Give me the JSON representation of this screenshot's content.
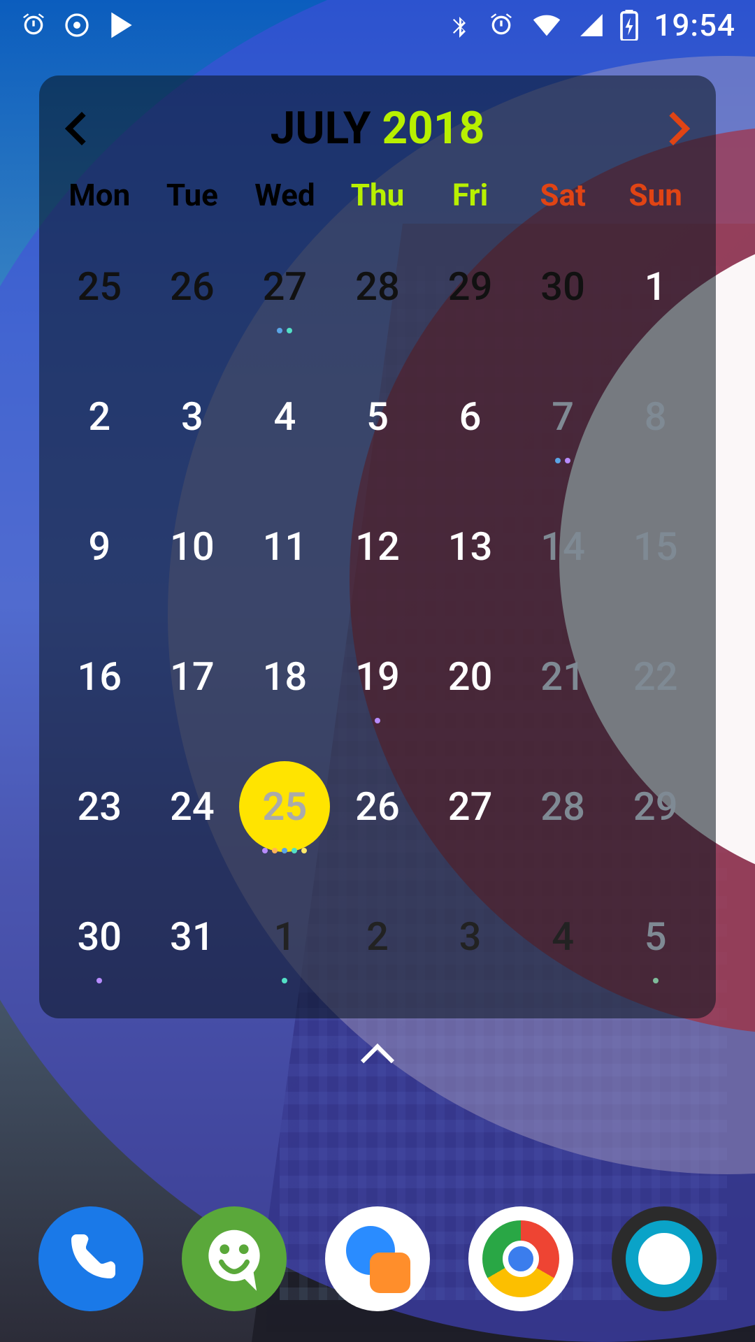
{
  "statusbar": {
    "time": "19:54",
    "left_icons": [
      "alarm-icon",
      "target-icon",
      "play-store-icon"
    ],
    "right_icons": [
      "bluetooth-icon",
      "alarm-icon",
      "wifi-icon",
      "cell-signal-icon",
      "battery-charging-icon"
    ]
  },
  "calendar": {
    "title_month": "JULY",
    "title_year": "2018",
    "prev_label": "Previous month",
    "next_label": "Next month",
    "dow": [
      "Mon",
      "Tue",
      "Wed",
      "Thu",
      "Fri",
      "Sat",
      "Sun"
    ],
    "dow_style": [
      "plain",
      "plain",
      "plain",
      "mid",
      "mid",
      "wknd sat",
      "wknd sun"
    ],
    "cells": [
      {
        "n": "25",
        "cls": "prev"
      },
      {
        "n": "26",
        "cls": "prev"
      },
      {
        "n": "27",
        "cls": "prev",
        "dots": [
          "b",
          "t"
        ]
      },
      {
        "n": "28",
        "cls": "prev"
      },
      {
        "n": "29",
        "cls": "prev"
      },
      {
        "n": "30",
        "cls": "prev"
      },
      {
        "n": "1",
        "cls": "cur"
      },
      {
        "n": "2",
        "cls": "cur"
      },
      {
        "n": "3",
        "cls": "cur"
      },
      {
        "n": "4",
        "cls": "cur"
      },
      {
        "n": "5",
        "cls": "cur"
      },
      {
        "n": "6",
        "cls": "cur"
      },
      {
        "n": "7",
        "cls": "cur wk-dim",
        "dots": [
          "b",
          "p"
        ]
      },
      {
        "n": "8",
        "cls": "cur wk-dim"
      },
      {
        "n": "9",
        "cls": "cur"
      },
      {
        "n": "10",
        "cls": "cur"
      },
      {
        "n": "11",
        "cls": "cur"
      },
      {
        "n": "12",
        "cls": "cur"
      },
      {
        "n": "13",
        "cls": "cur"
      },
      {
        "n": "14",
        "cls": "cur wk-dim"
      },
      {
        "n": "15",
        "cls": "cur wk-dim"
      },
      {
        "n": "16",
        "cls": "cur"
      },
      {
        "n": "17",
        "cls": "cur"
      },
      {
        "n": "18",
        "cls": "cur"
      },
      {
        "n": "19",
        "cls": "cur",
        "dots": [
          "p"
        ]
      },
      {
        "n": "20",
        "cls": "cur"
      },
      {
        "n": "21",
        "cls": "cur wk-dim"
      },
      {
        "n": "22",
        "cls": "cur wk-dim"
      },
      {
        "n": "23",
        "cls": "cur"
      },
      {
        "n": "24",
        "cls": "cur"
      },
      {
        "n": "25",
        "cls": "cur today",
        "dots": [
          "p",
          "o",
          "b",
          "t",
          "y"
        ]
      },
      {
        "n": "26",
        "cls": "cur"
      },
      {
        "n": "27",
        "cls": "cur"
      },
      {
        "n": "28",
        "cls": "cur wk-dim"
      },
      {
        "n": "29",
        "cls": "cur wk-dim"
      },
      {
        "n": "30",
        "cls": "cur",
        "dots": [
          "p"
        ]
      },
      {
        "n": "31",
        "cls": "cur"
      },
      {
        "n": "1",
        "cls": "next",
        "dots": [
          "t"
        ]
      },
      {
        "n": "2",
        "cls": "next"
      },
      {
        "n": "3",
        "cls": "next"
      },
      {
        "n": "4",
        "cls": "next"
      },
      {
        "n": "5",
        "cls": "next wk-dim",
        "dots": [
          "g"
        ]
      }
    ]
  },
  "dock": {
    "apps": [
      {
        "name": "phone-app",
        "label": "Phone"
      },
      {
        "name": "messages-app",
        "label": "Messages"
      },
      {
        "name": "duo-app",
        "label": "Duo"
      },
      {
        "name": "chrome-app",
        "label": "Chrome"
      },
      {
        "name": "browser-app",
        "label": "Browser"
      }
    ]
  }
}
